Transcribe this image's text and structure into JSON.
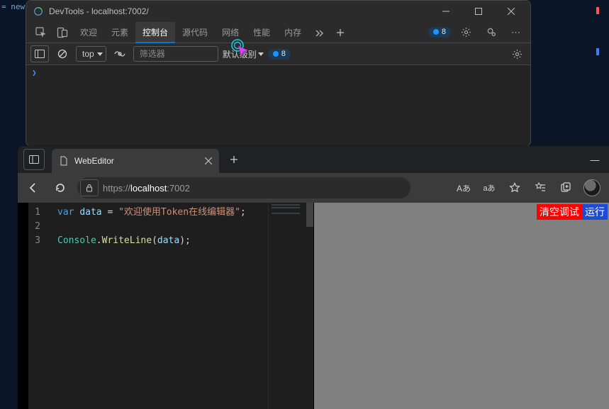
{
  "background": {
    "snippet": "= new"
  },
  "devtools": {
    "title": "DevTools - localhost:7002/",
    "tabs": {
      "welcome": "欢迎",
      "elements": "元素",
      "console": "控制台",
      "sources": "源代码",
      "network": "网络",
      "performance": "性能",
      "memory": "内存"
    },
    "issues_badge": "8",
    "toolbar": {
      "context": "top",
      "filter_placeholder": "筛选器",
      "level_label": "默认级别",
      "issues_count": "8"
    },
    "prompt": "❯"
  },
  "browser": {
    "tab_label": "WebEditor",
    "tabstrip_minimize": "―",
    "url": {
      "scheme": "https://",
      "host": "localhost",
      "port": ":7002"
    },
    "reader_label": "Aあ",
    "translate_label": "aあ"
  },
  "editor": {
    "lines": [
      "1",
      "2",
      "3"
    ],
    "code": {
      "l1": {
        "kw": "var",
        "id": "data",
        "op": " = ",
        "str": "\"欢迎使用Token在线编辑器\"",
        "end": ";"
      },
      "l3": {
        "type": "Console",
        "dot": ".",
        "fn": "WriteLine",
        "lp": "(",
        "arg": "data",
        "rp": ")",
        "end": ";"
      }
    }
  },
  "output": {
    "clear_btn": "清空调试",
    "run_btn": "运行"
  }
}
